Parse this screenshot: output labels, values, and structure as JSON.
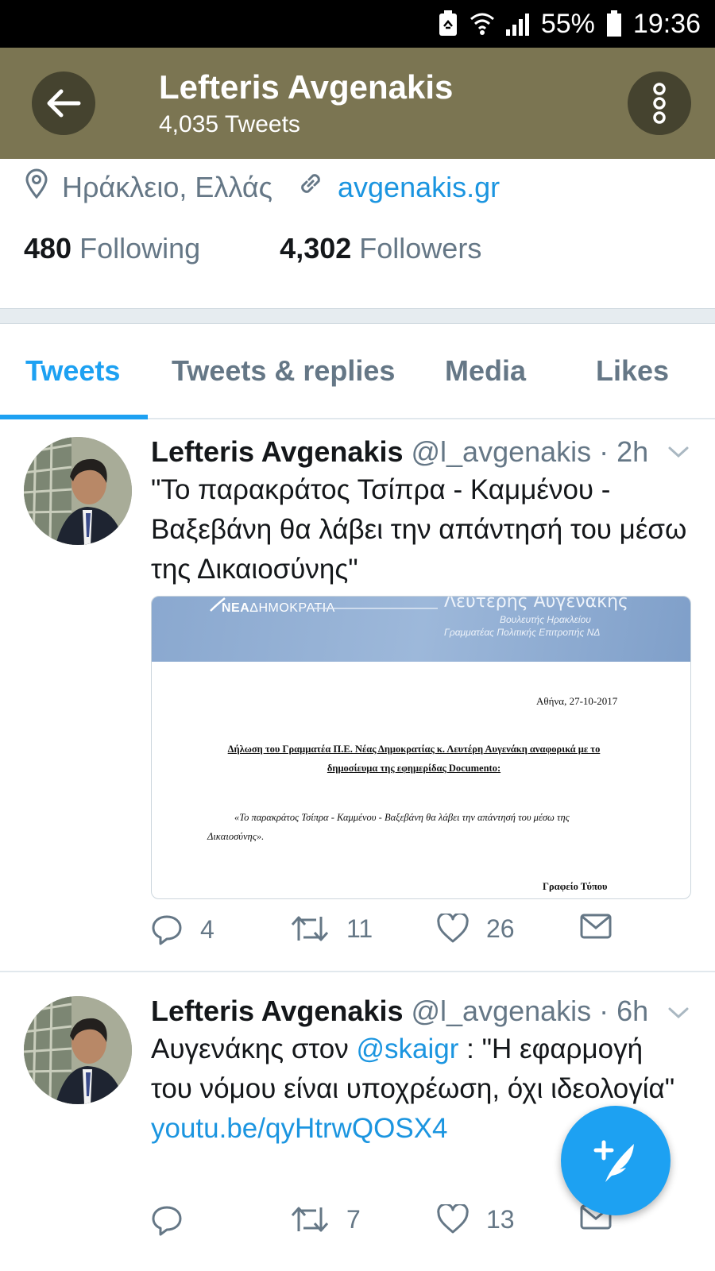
{
  "status_bar": {
    "battery_percent": "55%",
    "time": "19:36",
    "icons": [
      "battery-saver-icon",
      "wifi-icon",
      "signal-icon",
      "battery-icon"
    ]
  },
  "header": {
    "name": "Lefteris Avgenakis",
    "tweet_count": "4,035 Tweets",
    "background_color": "#7b7552"
  },
  "profile": {
    "location": "Ηράκλειο, Ελλάς",
    "website": "avgenakis.gr",
    "following_count": "480",
    "following_label": "Following",
    "followers_count": "4,302",
    "followers_label": "Followers"
  },
  "tabs": [
    {
      "label": "Tweets",
      "active": true
    },
    {
      "label": "Tweets & replies",
      "active": false
    },
    {
      "label": "Media",
      "active": false
    },
    {
      "label": "Likes",
      "active": false
    }
  ],
  "tweets": [
    {
      "name": "Lefteris Avgenakis",
      "handle": "@l_avgenakis",
      "time": "· 2h",
      "text": "\"Το παρακράτος Τσίπρα - Καμμένου - Βαξεβάνη θα λάβει την απάντησή του μέσω της Δικαιοσύνης\"",
      "media": {
        "logo_bold": "ΝΕΑ",
        "logo_rest": "ΔΗΜΟΚΡΑΤΙΑ",
        "header_name": "Λευτέρης Αυγενάκης",
        "header_sub1": "Βουλευτής Ηρακλείου",
        "header_sub2": "Γραμματέας Πολιτικής Επιτροπής ΝΔ",
        "date": "Αθήνα, 27-10-2017",
        "heading": "Δήλωση του Γραμματέα Π.Ε. Νέας Δημοκρατίας κ. Λευτέρη Αυγενάκη αναφορικά με το δημοσίευμα της εφημερίδας Documento:",
        "body": "«Το παρακράτος Τσίπρα - Καμμένου - Βαξεβάνη θα λάβει την απάντησή του μέσω της Δικαιοσύνης».",
        "signature": "Γραφείο Τύπου"
      },
      "replies": "4",
      "retweets": "11",
      "likes": "26"
    },
    {
      "name": "Lefteris Avgenakis",
      "handle": "@l_avgenakis",
      "time": "· 6h",
      "text_before": "Αυγενάκης στον ",
      "mention": "@skaigr",
      "text_after": " : \"Η εφαρμογή του νόμου είναι υποχρέωση, όχι ιδεολογία\"",
      "link": "youtu.be/qyHtrwQOSX4",
      "replies": "",
      "retweets": "7",
      "likes": "13"
    }
  ],
  "fab": {
    "icon": "compose-tweet-icon"
  },
  "colors": {
    "accent": "#1da1f2",
    "link": "#1b95e0",
    "muted": "#657786"
  }
}
